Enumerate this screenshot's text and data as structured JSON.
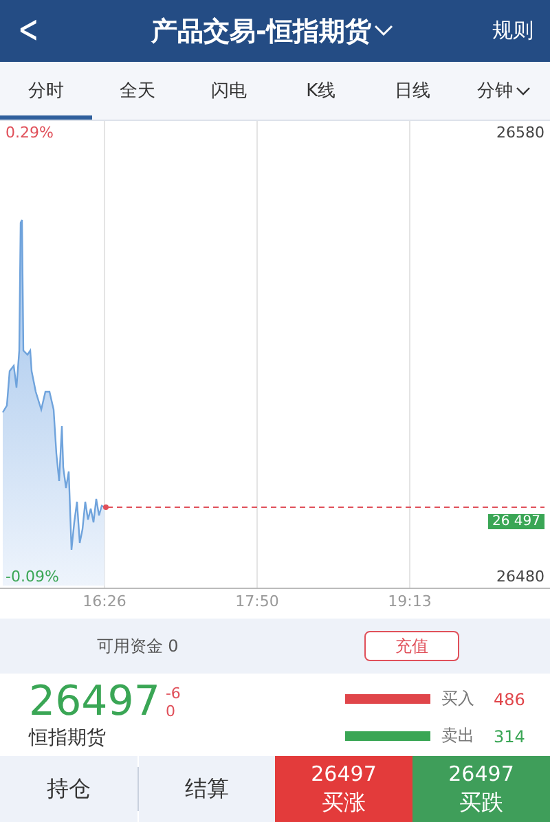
{
  "header": {
    "back_icon": "<",
    "title": "产品交易-恒指期货",
    "rules": "规则"
  },
  "tabs": [
    {
      "label": "分时",
      "selected": true,
      "dropdown": false
    },
    {
      "label": "全天",
      "selected": false,
      "dropdown": false
    },
    {
      "label": "闪电",
      "selected": false,
      "dropdown": false
    },
    {
      "label": "K线",
      "selected": false,
      "dropdown": false
    },
    {
      "label": "日线",
      "selected": false,
      "dropdown": false
    },
    {
      "label": "分钟",
      "selected": false,
      "dropdown": true
    }
  ],
  "chart": {
    "top_change": "0.29%",
    "bottom_change": "-0.09%",
    "top_price": "26580",
    "bottom_price": "26480",
    "current_price": "26 497",
    "times": [
      "16:26",
      "17:50",
      "19:13"
    ]
  },
  "funds": {
    "label": "可用资金 0",
    "deposit_button": "充值"
  },
  "quote": {
    "price": "26497",
    "change": "-6",
    "change_pct": "0",
    "name": "恒指期货",
    "depth": [
      {
        "kind": "buy",
        "label": "买入",
        "volume": "486"
      },
      {
        "kind": "sell",
        "label": "卖出",
        "volume": "314"
      }
    ]
  },
  "actions": [
    {
      "kind": "plain",
      "label": "持仓"
    },
    {
      "kind": "plain",
      "label": "结算"
    },
    {
      "kind": "up",
      "price": "26497",
      "label": "买涨"
    },
    {
      "kind": "down",
      "price": "26497",
      "label": "买跌"
    }
  ]
}
